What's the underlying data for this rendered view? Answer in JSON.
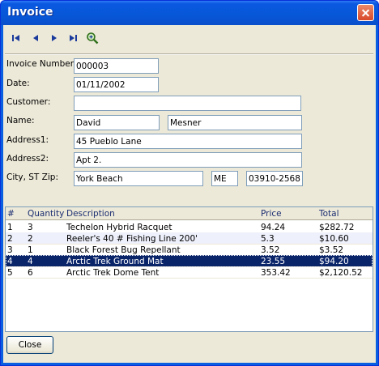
{
  "window": {
    "title": "Invoice"
  },
  "toolbar": {
    "buttons": [
      {
        "name": "first-record-icon"
      },
      {
        "name": "previous-record-icon"
      },
      {
        "name": "next-record-icon"
      },
      {
        "name": "last-record-icon"
      },
      {
        "name": "search-icon"
      }
    ]
  },
  "form": {
    "invoice_number_label": "Invoice Number:",
    "invoice_number": "000003",
    "date_label": "Date:",
    "date": "01/11/2002",
    "customer_label": "Customer:",
    "customer": "",
    "name_label": "Name:",
    "first_name": "David",
    "last_name": "Mesner",
    "address1_label": "Address1:",
    "address1": "45 Pueblo Lane",
    "address2_label": "Address2:",
    "address2": "Apt 2.",
    "city_label": "City, ST Zip:",
    "city": "York Beach",
    "state": "ME",
    "zip": "03910-2568"
  },
  "grid": {
    "columns": [
      "#",
      "Quantity",
      "Description",
      "Price",
      "Total"
    ],
    "rows": [
      {
        "num": "1",
        "qty": "3",
        "desc": "Techelon Hybrid Racquet",
        "price": "94.24",
        "total": "$282.72"
      },
      {
        "num": "2",
        "qty": "2",
        "desc": "Reeler's 40 # Fishing Line 200'",
        "price": "5.3",
        "total": "$10.60"
      },
      {
        "num": "3",
        "qty": "1",
        "desc": "Black Forest Bug Repellant",
        "price": "3.52",
        "total": "$3.52"
      },
      {
        "num": "4",
        "qty": "4",
        "desc": "Arctic Trek Ground Mat",
        "price": "23.55",
        "total": "$94.20"
      },
      {
        "num": "5",
        "qty": "6",
        "desc": "Arctic Trek Dome Tent",
        "price": "353.42",
        "total": "$2,120.52"
      }
    ],
    "selected_row": 3
  },
  "buttons": {
    "close_label": "Close"
  },
  "colors": {
    "title_bar": "#0a58e0",
    "selection": "#0a246a",
    "face": "#ece9d8"
  }
}
